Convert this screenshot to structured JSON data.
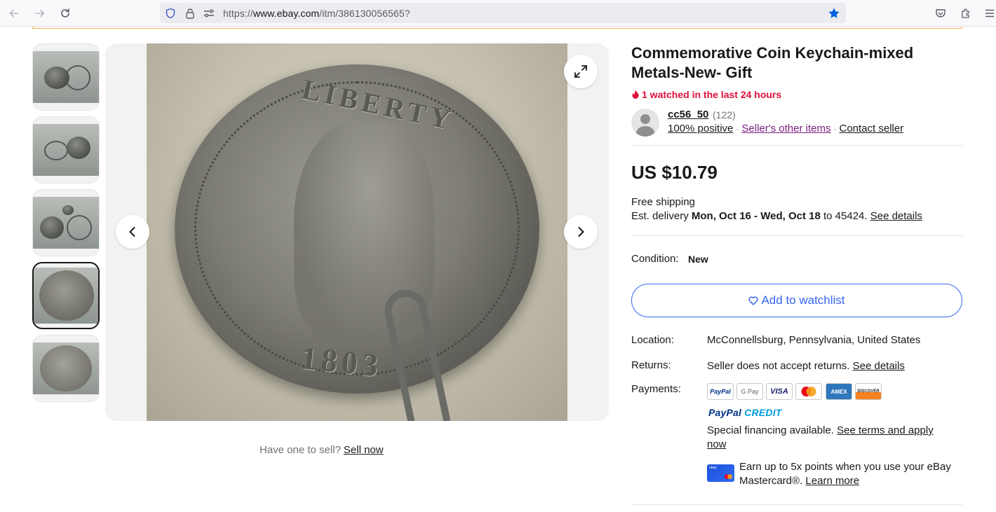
{
  "browser": {
    "url_prefix": "https://",
    "url_host": "www.ebay.com",
    "url_path": "/itm/386130056565?"
  },
  "gallery": {
    "thumbnail_count": 5,
    "selected_index": 3
  },
  "sell_prompt": {
    "text": "Have one to sell?",
    "link": "Sell now"
  },
  "listing": {
    "title": "Commemorative Coin Keychain-mixed Metals-New- Gift",
    "watched": "1 watched in the last 24 hours",
    "seller": {
      "name": "cc56_50",
      "feedback_count": "(122)",
      "positive": "100% positive",
      "other_items": "Seller's other items",
      "contact": "Contact seller"
    },
    "price": "US $10.79",
    "shipping": {
      "free": "Free shipping",
      "est_prefix": "Est. delivery",
      "date_range": "Mon, Oct 16 - Wed, Oct 18",
      "to_zip": "to 45424.",
      "details_link": "See details"
    },
    "condition": {
      "label": "Condition:",
      "value": "New"
    },
    "watch_button": "Add to watchlist",
    "location": {
      "label": "Location:",
      "value": "McConnellsburg, Pennsylvania, United States"
    },
    "returns": {
      "label": "Returns:",
      "value": "Seller does not accept returns.",
      "link": "See details"
    },
    "payments": {
      "label": "Payments:",
      "methods": [
        "PayPal",
        "G Pay",
        "VISA",
        "Mastercard",
        "AMEX",
        "DISCOVER"
      ],
      "paypal_credit_a": "PayPal",
      "paypal_credit_b": "CREDIT",
      "financing_text": "Special financing available.",
      "financing_link": "See terms and apply now",
      "earn_text": "Earn up to 5x points when you use your eBay Mastercard®.",
      "earn_link": "Learn more"
    }
  },
  "colors": {
    "accent_blue": "#3665f3",
    "watched_red": "#e0103a",
    "seller_purple": "#7a1f80",
    "paypal_navy": "#003087",
    "paypal_light": "#009cde"
  },
  "icons": [
    "back-icon",
    "forward-icon",
    "reload-icon",
    "shield-icon",
    "lock-icon",
    "permissions-icon",
    "bookmark-star-icon",
    "pocket-icon",
    "extensions-icon",
    "menu-icon",
    "expand-icon",
    "chevron-left-icon",
    "chevron-right-icon",
    "flame-icon",
    "heart-icon"
  ]
}
